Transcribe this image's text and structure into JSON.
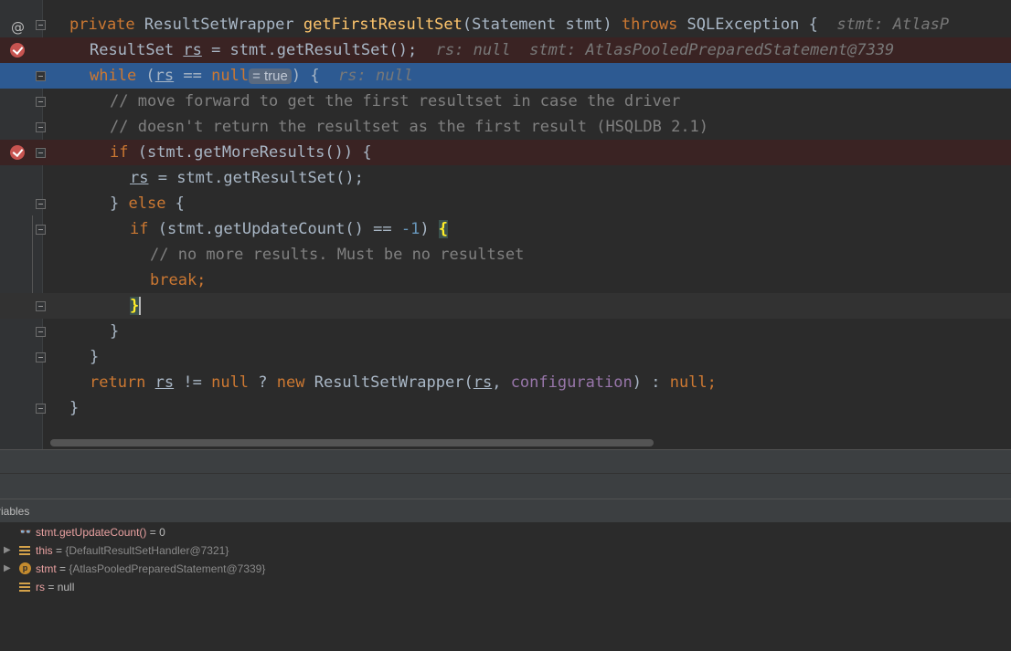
{
  "editor": {
    "lines": {
      "l1": {
        "kw1": "private ",
        "type1": "ResultSetWrapper ",
        "fn": "getFirstResultSet",
        "args": "(Statement stmt) ",
        "kw2": "throws ",
        "rest": "SQLException {",
        "hint": "stmt: AtlasP"
      },
      "l2": {
        "a": "ResultSet ",
        "rs": "rs",
        "b": " = stmt.getResultSet();",
        "hint1": "rs: null",
        "hint2": "stmt: AtlasPooledPreparedStatement@7339"
      },
      "l3": {
        "kw": "while ",
        "a": "(",
        "rs": "rs",
        "b": " == ",
        "kw2": "null",
        "inlay": "= true",
        "c": ") {",
        "hint": "rs: null"
      },
      "l4": "// move forward to get the first resultset in case the driver",
      "l5": "// doesn't return the resultset as the first result (HSQLDB 2.1)",
      "l6": {
        "kw": "if ",
        "rest": "(stmt.getMoreResults()) {"
      },
      "l7": {
        "rs": "rs",
        "rest": " = stmt.getResultSet();"
      },
      "l8": {
        "a": "} ",
        "kw": "else",
        "b": " {"
      },
      "l9": {
        "kw": "if ",
        "a": "(stmt.getUpdateCount() == ",
        "num": "-1",
        "b": ") ",
        "brace": "{"
      },
      "l10": "// no more results. Must be no resultset",
      "l11": "break;",
      "l12": "}",
      "l13": "}",
      "l14": "}",
      "l15": {
        "kw": "return ",
        "rs": "rs",
        "a": " != ",
        "kw2": "null",
        "b": " ? ",
        "kw3": "new ",
        "c": "ResultSetWrapper(",
        "rs2": "rs",
        "d": ", ",
        "fld": "configuration",
        "e": ") : ",
        "kw4": "null",
        "f": ";"
      },
      "l16": "}"
    }
  },
  "debugger": {
    "variables_title": "riables",
    "variables": [
      {
        "name": "stmt.getUpdateCount()",
        "sep": " = ",
        "value": "0",
        "icon": "watch-glasses-icon"
      },
      {
        "name": "this",
        "sep": " = ",
        "value": "{DefaultResultSetHandler@7321}",
        "icon": "field-icon"
      },
      {
        "name": "stmt",
        "sep": " = ",
        "value": "{AtlasPooledPreparedStatement@7339}",
        "icon": "parameter-icon"
      },
      {
        "name": "rs",
        "sep": " = ",
        "value": "null",
        "icon": "field-icon"
      }
    ]
  },
  "colors": {
    "background": "#2b2b2b",
    "execution_line": "#2d5a92",
    "breakpoint_line": "#3a2323",
    "breakpoint": "#c75450",
    "keyword": "#cc7832",
    "method": "#ffc66d",
    "comment": "#808080"
  }
}
